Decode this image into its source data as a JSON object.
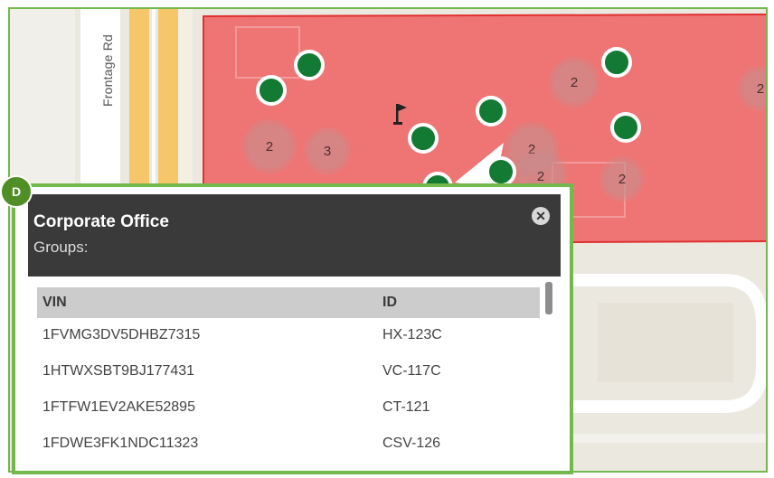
{
  "map": {
    "road_label": "Frontage Rd",
    "colors": {
      "geofence_fill": "#ef7575",
      "geofence_border": "#e03030",
      "marker": "#137a33",
      "frame": "#72b84c"
    },
    "clusters": [
      {
        "count": "2"
      },
      {
        "count": "3"
      },
      {
        "count": "2"
      },
      {
        "count": "2"
      },
      {
        "count": "2"
      },
      {
        "count": "2"
      },
      {
        "count": "2"
      }
    ]
  },
  "annotation": {
    "badge": "D"
  },
  "popup": {
    "title": "Corporate Office",
    "groups_label": "Groups:",
    "close_icon": "close-icon",
    "columns": [
      "VIN",
      "ID"
    ],
    "rows": [
      {
        "vin": "1FVMG3DV5DHBZ7315",
        "id": "HX-123C"
      },
      {
        "vin": "1HTWXSBT9BJ177431",
        "id": "VC-117C"
      },
      {
        "vin": "1FTFW1EV2AKE52895",
        "id": "CT-121"
      },
      {
        "vin": "1FDWE3FK1NDC11323",
        "id": "CSV-126"
      }
    ]
  }
}
